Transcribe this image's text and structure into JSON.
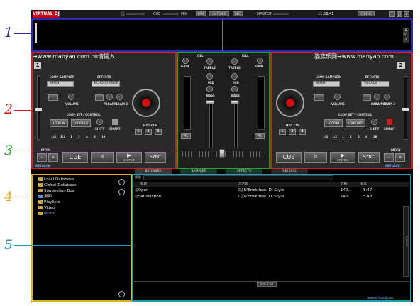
{
  "app": {
    "logo": "VIRTUAL DJ",
    "cue_label": "CUE",
    "mix_label": "MIX",
    "master_label": "MASTER",
    "buttons": [
      "BPM",
      "AUTOMIX",
      "REC"
    ],
    "clock": "11:58:41",
    "config": "CONFIG",
    "window_buttons": [
      "_",
      "□",
      "x"
    ]
  },
  "scope": {
    "right_markers": [
      "1",
      "D",
      "2"
    ]
  },
  "deck_left": {
    "title": "→www.manyao.com.cn请输入",
    "number": "1",
    "loop_sampler": "LOOP SAMPLER",
    "effects": "EFFECTS",
    "sampler_value": "SIREN",
    "effect_value": "ECHO CHANGE",
    "volume": "VOLUME",
    "param1": "PARAM 1",
    "param2": "PARAM 2",
    "loop_set": "LOOP SET / CONTROL",
    "loop_in": "LOOP IN",
    "loop_out": "LOOP OUT",
    "shift": "SHIFT",
    "smart": "SMART",
    "hot_cue": "HOT CUE",
    "hot_cue_nums": [
      "1",
      "2",
      "3"
    ],
    "loop_lengths": [
      "1/4",
      "1/2",
      "1",
      "2",
      "4",
      "8",
      "16"
    ],
    "pitch": "PITCH",
    "keylock": "KEYLOCK",
    "cue": "CUE",
    "play": "▶",
    "stutter": "STUTTER",
    "pause": "II",
    "sync": "SYNC"
  },
  "deck_right": {
    "title": "猫族乐网→www.manyao.com",
    "number": "2",
    "loop_sampler": "LOOP SAMPLER",
    "effects": "EFFECTS",
    "sampler_value": "SIREN",
    "effect_value": "VOCALS",
    "volume": "VOLUME",
    "param1": "PARAM 1",
    "param2": "PARAM 2",
    "loop_set": "LOOP SET / CONTROL",
    "loop_in": "LOOP IN",
    "loop_out": "LOOP OUT",
    "shift": "SHIFT",
    "smart": "SMART",
    "hot_cue": "HOT CUE",
    "hot_cue_nums": [
      "1",
      "2",
      "3"
    ],
    "loop_lengths": [
      "1/4",
      "1/2",
      "1",
      "2",
      "4",
      "8",
      "16"
    ],
    "pitch": "PITCH",
    "keylock": "KEYLOCK",
    "cue": "CUE",
    "play": "▶",
    "stutter": "STUTTER",
    "pause": "II",
    "sync": "SYNC"
  },
  "mixer": {
    "gain": "GAIN",
    "kill": "KILL",
    "treble": "TREBLE",
    "mid": "MID",
    "bass": "BASS",
    "pfl": "PFL"
  },
  "browser": {
    "tabs": [
      "BROWSER",
      "SAMPLER",
      "EFFECTS",
      "RECORD"
    ],
    "tree": [
      {
        "label": "Local Database"
      },
      {
        "label": "Global Database"
      },
      {
        "label": "Suggestion Box"
      },
      {
        "label": "桌面"
      },
      {
        "label": "Playlists"
      },
      {
        "label": "Video"
      },
      {
        "label": "Music"
      }
    ],
    "search_label": "搜索",
    "columns": [
      "标题",
      "艺术家",
      "节拍",
      "长度"
    ],
    "rows": [
      {
        "title": "Open",
        "artist": "DJ N'Erick feat. DJ Style",
        "bpm": "140...",
        "length": "5:47"
      },
      {
        "title": "Satisfaction",
        "artist": "DJ N'Erick feat. DJ Style",
        "bpm": "142...",
        "length": "5:48"
      }
    ],
    "side_list": "SIDE LIST",
    "footer": "www.virtualdj.com",
    "side_tab": "PLAYLIST"
  },
  "callouts": {
    "items": [
      "1",
      "2",
      "3",
      "4",
      "5"
    ],
    "colors": {
      "1": "#2b2bb0",
      "2": "#d81b1b",
      "3": "#1aa51a",
      "4": "#e0b11a",
      "5": "#1a9fb8"
    }
  }
}
